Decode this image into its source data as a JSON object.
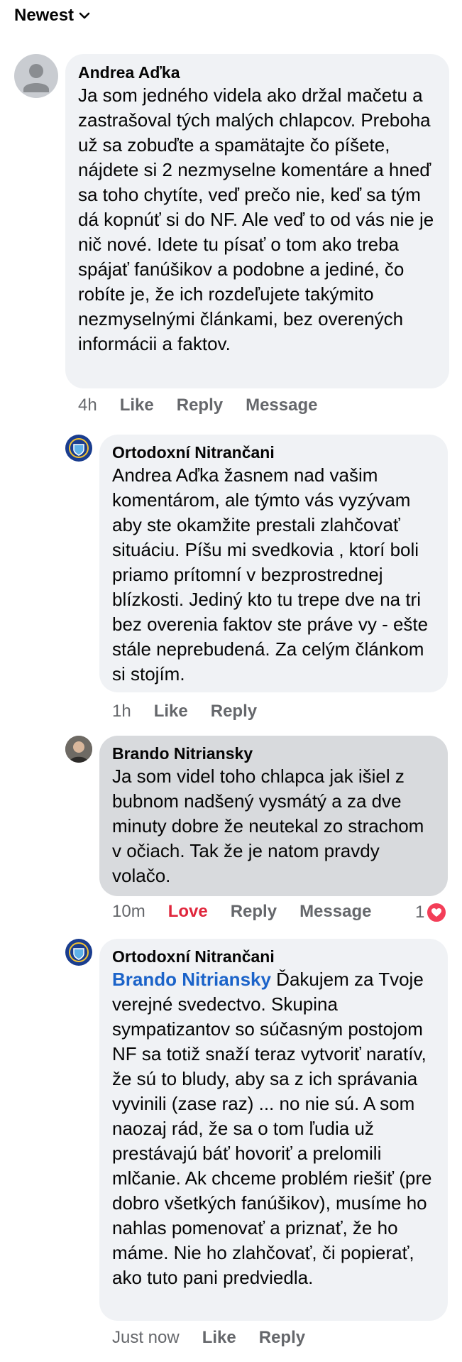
{
  "sort": {
    "label": "Newest"
  },
  "comments": [
    {
      "author": "Andrea Aďka",
      "text": "Ja som jedného videla ako držal mačetu a zastrašoval tých malých chlapcov. Preboha už sa zobuďte a spamätajte čo píšete, nájdete si 2 nezmyselne komentáre a hneď sa toho chytíte, veď prečo nie, keď sa tým dá kopnúť si do NF. Ale veď to od vás nie je nič nové. Idete tu písať o tom ako treba spájať fanúšikov a podobne a jediné, čo robíte je, že ich rozdeľujete takýmito nezmyselnými článkami, bez overených informácii a faktov.",
      "time": "4h",
      "like": "Like",
      "reply": "Reply",
      "message": "Message"
    },
    {
      "author": "Ortodoxní Nitrančani",
      "text": "Andrea Aďka žasnem nad vašim komentárom,  ale týmto vás vyzývam aby ste okamžite prestali zlahčovať situáciu. Píšu mi svedkovia , ktorí boli priamo prítomní v bezprostrednej blízkosti.  Jediný kto tu trepe dve na tri bez overenia faktov ste práve vy - ešte stále neprebudená. Za celým článkom si stojím.",
      "time": "1h",
      "like": "Like",
      "reply": "Reply"
    },
    {
      "author": "Brando Nitriansky",
      "text": "Ja som videl toho chlapca jak išiel z bubnom nadšený vysmátý a za dve minuty dobre že neutekal zo strachom v očiach. Tak že je natom pravdy volačo.",
      "time": "10m",
      "like": "Love",
      "reply": "Reply",
      "message": "Message",
      "reaction_count": "1",
      "reaction_color": "#f33e58"
    },
    {
      "author": "Ortodoxní Nitrančani",
      "mention": "Brando Nitriansky",
      "text": " Ďakujem za Tvoje verejné svedectvo. Skupina sympatizantov so súčasným postojom NF sa totiž snaží teraz vytvoriť naratív, že sú to bludy, aby sa z ich správania vyvinili (zase raz) ... no nie sú.  A som naozaj rád,  že sa o tom ľudia už prestávajú báť hovoriť a prelomili mlčanie. Ak chceme problém riešiť (pre dobro všetkých fanúšikov), musíme ho nahlas pomenovať a priznať, že ho máme. Nie ho zlahčovať, či popierať, ako tuto pani predviedla.",
      "time": "Just now",
      "like": "Like",
      "reply": "Reply"
    }
  ]
}
